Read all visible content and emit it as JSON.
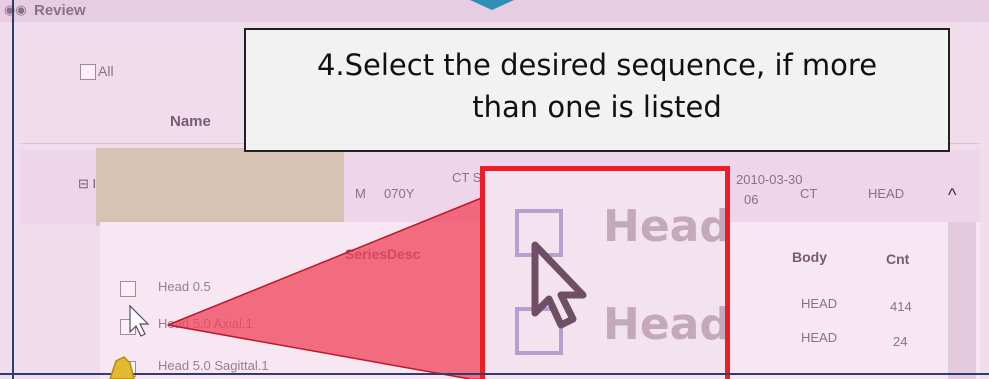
{
  "window": {
    "title": "Review",
    "icon": "review-icon"
  },
  "toolbar": {
    "select_all_label": "All"
  },
  "table": {
    "header_name": "Name",
    "study_row": {
      "sex": "M",
      "age": "070Y",
      "description": "CT SCAN BRAIN",
      "date_fragment": "2010-03-30",
      "time_fragment": "06",
      "modality": "CT",
      "body": "HEAD"
    },
    "series_headers": {
      "desc": "SeriesDesc",
      "body": "Body",
      "count": "Cnt"
    },
    "series": [
      {
        "desc": "Head 0.5",
        "body": "HEAD",
        "count": "414"
      },
      {
        "desc": "Head 5.0 Axial.1",
        "body": "HEAD",
        "count": "24"
      },
      {
        "desc": "Head 5.0 Sagittal.1",
        "body": "",
        "count": ""
      }
    ]
  },
  "callout": {
    "line1": "4.Select the desired sequence, if more",
    "line2": "than one is listed"
  },
  "zoom": {
    "label1": "Head",
    "label2": "Head"
  },
  "colors": {
    "callout_border": "#222222",
    "zoom_border": "#ee1c24",
    "triangle_fill": "#f0435a",
    "ui_background": "#f1dceb"
  }
}
